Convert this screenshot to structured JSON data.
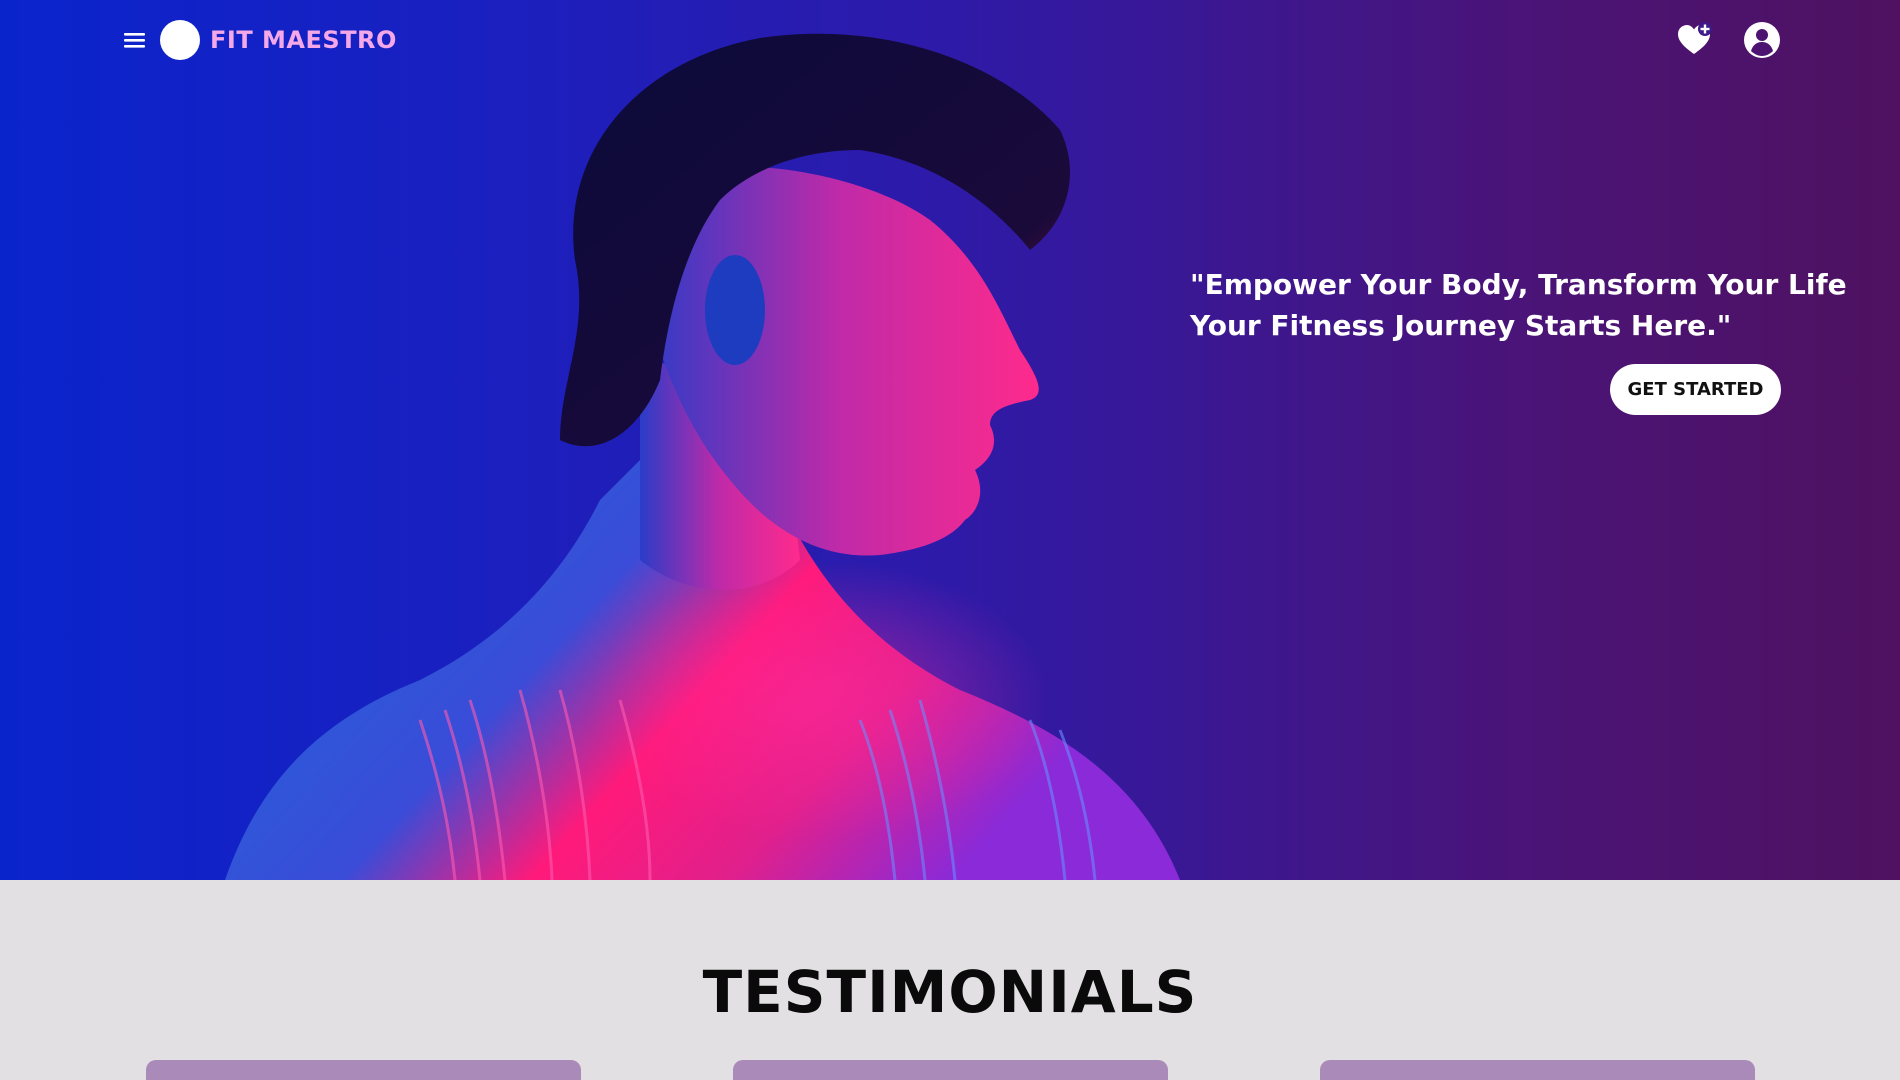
{
  "header": {
    "brand_name": "FIT MAESTRO",
    "menu_icon": "hamburger-menu-icon",
    "favorites_icon": "heart-plus-icon",
    "account_icon": "user-circle-icon"
  },
  "hero": {
    "tagline_line1": "\"Empower Your Body, Transform Your Life",
    "tagline_line2": "Your Fitness Journey Starts Here.\"",
    "cta_label": "GET STARTED",
    "image_subject": "man-profile-neon-portrait"
  },
  "testimonials": {
    "title": "TESTIMONIALS",
    "card_count": 3
  },
  "colors": {
    "hero_gradient_start": "#0a24cc",
    "hero_gradient_end": "#4f1160",
    "brand_name": "#f4a8e8",
    "section_bg": "#e2e0e3",
    "card_bg": "#a98ab8",
    "button_bg": "#ffffff"
  }
}
